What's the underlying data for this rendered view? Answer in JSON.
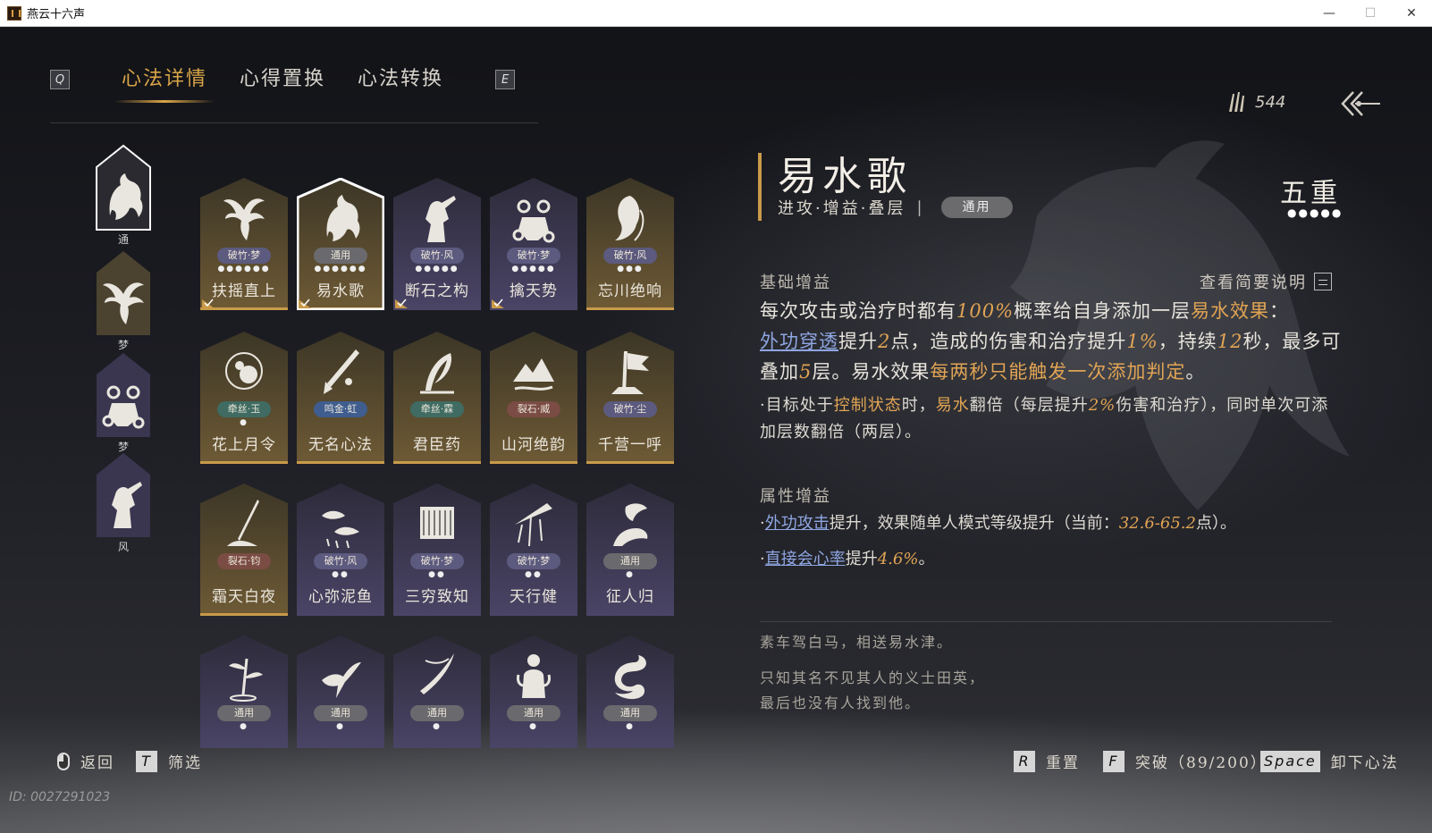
{
  "window": {
    "title": "燕云十六声",
    "minimize": "—",
    "maximize": "☐",
    "close": "✕"
  },
  "tabs": {
    "prev_key": "Q",
    "next_key": "E",
    "items": [
      {
        "label": "心法详情",
        "active": true
      },
      {
        "label": "心得置换",
        "active": false
      },
      {
        "label": "心法转换",
        "active": false
      }
    ]
  },
  "currency": {
    "icon": "currency-feathers-icon",
    "value": "544"
  },
  "side_categories": [
    {
      "label": "通",
      "icon": "horse-icon",
      "selected": true
    },
    {
      "label": "梦",
      "icon": "eagle-icon",
      "selected": false
    },
    {
      "label": "梦",
      "icon": "chained-fist-icon",
      "selected": false
    },
    {
      "label": "风",
      "icon": "warrior-icon",
      "selected": false
    }
  ],
  "cards": [
    {
      "name": "扶摇直上",
      "tag": "破竹·梦",
      "dots": "●●●●●●",
      "tier": "gold",
      "icon": "eagle-icon",
      "checked": true,
      "selected": false
    },
    {
      "name": "易水歌",
      "tag": "通用",
      "dots": "●●●●●●",
      "tier": "gold",
      "icon": "horse-icon",
      "checked": true,
      "selected": true
    },
    {
      "name": "断石之构",
      "tag": "破竹·风",
      "dots": "●●●●●",
      "tier": "purple",
      "icon": "warrior-icon",
      "checked": true,
      "selected": false
    },
    {
      "name": "擒天势",
      "tag": "破竹·梦",
      "dots": "●●●●●",
      "tier": "purple",
      "icon": "chained-fist-icon",
      "checked": true,
      "selected": false
    },
    {
      "name": "忘川绝响",
      "tag": "破竹·风",
      "dots": "●●●",
      "tier": "gold",
      "icon": "spirit-icon",
      "checked": false,
      "selected": false
    },
    {
      "name": "花上月令",
      "tag": "牵丝·玉",
      "dots": "●",
      "tier": "gold",
      "icon": "flower-moon-icon",
      "checked": false,
      "selected": false
    },
    {
      "name": "无名心法",
      "tag": "鸣金·虹",
      "dots": "",
      "tier": "gold",
      "icon": "sword-icon",
      "checked": false,
      "selected": false
    },
    {
      "name": "君臣药",
      "tag": "牵丝·霖",
      "dots": "",
      "tier": "gold",
      "icon": "herb-icon",
      "checked": false,
      "selected": false
    },
    {
      "name": "山河绝韵",
      "tag": "裂石·威",
      "dots": "",
      "tier": "gold",
      "icon": "mountain-icon",
      "checked": false,
      "selected": false
    },
    {
      "name": "千营一呼",
      "tag": "破竹·尘",
      "dots": "",
      "tier": "gold",
      "icon": "banner-icon",
      "checked": false,
      "selected": false
    },
    {
      "name": "霜天白夜",
      "tag": "裂石·钧",
      "dots": "",
      "tier": "gold",
      "icon": "spear-icon",
      "checked": false,
      "selected": false
    },
    {
      "name": "心弥泥鱼",
      "tag": "破竹·风",
      "dots": "●●",
      "tier": "purple",
      "icon": "fish-icon",
      "checked": false,
      "selected": false
    },
    {
      "name": "三穷致知",
      "tag": "破竹·梦",
      "dots": "●●",
      "tier": "purple",
      "icon": "scroll-icon",
      "checked": false,
      "selected": false
    },
    {
      "name": "天行健",
      "tag": "破竹·梦",
      "dots": "●●",
      "tier": "purple",
      "icon": "umbrella-icon",
      "checked": false,
      "selected": false
    },
    {
      "name": "征人归",
      "tag": "通用",
      "dots": "●",
      "tier": "purple",
      "icon": "bird-hand-icon",
      "checked": false,
      "selected": false
    },
    {
      "name": "",
      "tag": "通用",
      "dots": "●",
      "tier": "purple",
      "icon": "bamboo-icon",
      "checked": false,
      "selected": false
    },
    {
      "name": "",
      "tag": "通用",
      "dots": "●",
      "tier": "purple",
      "icon": "swallow-icon",
      "checked": false,
      "selected": false
    },
    {
      "name": "",
      "tag": "通用",
      "dots": "●",
      "tier": "purple",
      "icon": "blade-icon",
      "checked": false,
      "selected": false
    },
    {
      "name": "",
      "tag": "通用",
      "dots": "●",
      "tier": "purple",
      "icon": "statue-icon",
      "checked": false,
      "selected": false
    },
    {
      "name": "",
      "tag": "通用",
      "dots": "●",
      "tier": "purple",
      "icon": "dragon-icon",
      "checked": false,
      "selected": false
    }
  ],
  "detail": {
    "title": "易水歌",
    "subtitle": "进攻·增益·叠层",
    "pill": "通用",
    "rank": "五重",
    "rank_dots": "●●●●●",
    "base_heading": "基础增益",
    "brief_link": "查看简要说明",
    "p1": {
      "a": "每次攻击或治疗时都有",
      "b": "100%",
      "c": "概率给自身添加一层",
      "d": "易水效果",
      "e": "：",
      "f": "外功穿透",
      "g": "提升",
      "h": "2",
      "i": "点，造成的伤害和治疗提升",
      "j": "1%",
      "k": "，持续",
      "l": "12",
      "m": "秒，最多可叠加",
      "n": "5",
      "o": "层。易水效果",
      "p": "每两秒只能触发一次添加判定",
      "q": "。"
    },
    "p2": {
      "a": "·目标处于",
      "b": "控制状态",
      "c": "时，",
      "d": "易水",
      "e": "翻倍（每层提升",
      "f": "2%",
      "g": "伤害和治疗），同时单次可添加层数翻倍（两层）。"
    },
    "attr_heading": "属性增益",
    "p3": {
      "a": "·",
      "b": "外功攻击",
      "c": "提升，效果随单人模式等级提升（当前：",
      "d": "32.6-65.2",
      "e": "点）。"
    },
    "p4": {
      "a": "·",
      "b": "直接会心率",
      "c": "提升",
      "d": "4.6%",
      "e": "。"
    },
    "quote1": "素车驾白马，相送易水津。",
    "quote2": "只知其名不见其人的义士田英，",
    "quote3": "最后也没有人找到他。"
  },
  "footer": {
    "back": "返回",
    "filter_key": "T",
    "filter": "筛选",
    "reset_key": "R",
    "reset": "重置",
    "breakthrough_key": "F",
    "breakthrough": "突破（89/200）",
    "unequip_key": "Space",
    "unequip": "卸下心法"
  },
  "uid": "ID: 0027291023",
  "colors": {
    "accent_gold": "#d9a548",
    "link_blue": "#8fa6e2",
    "card_gold": "#6e5a35",
    "card_purple": "#3a3550"
  }
}
